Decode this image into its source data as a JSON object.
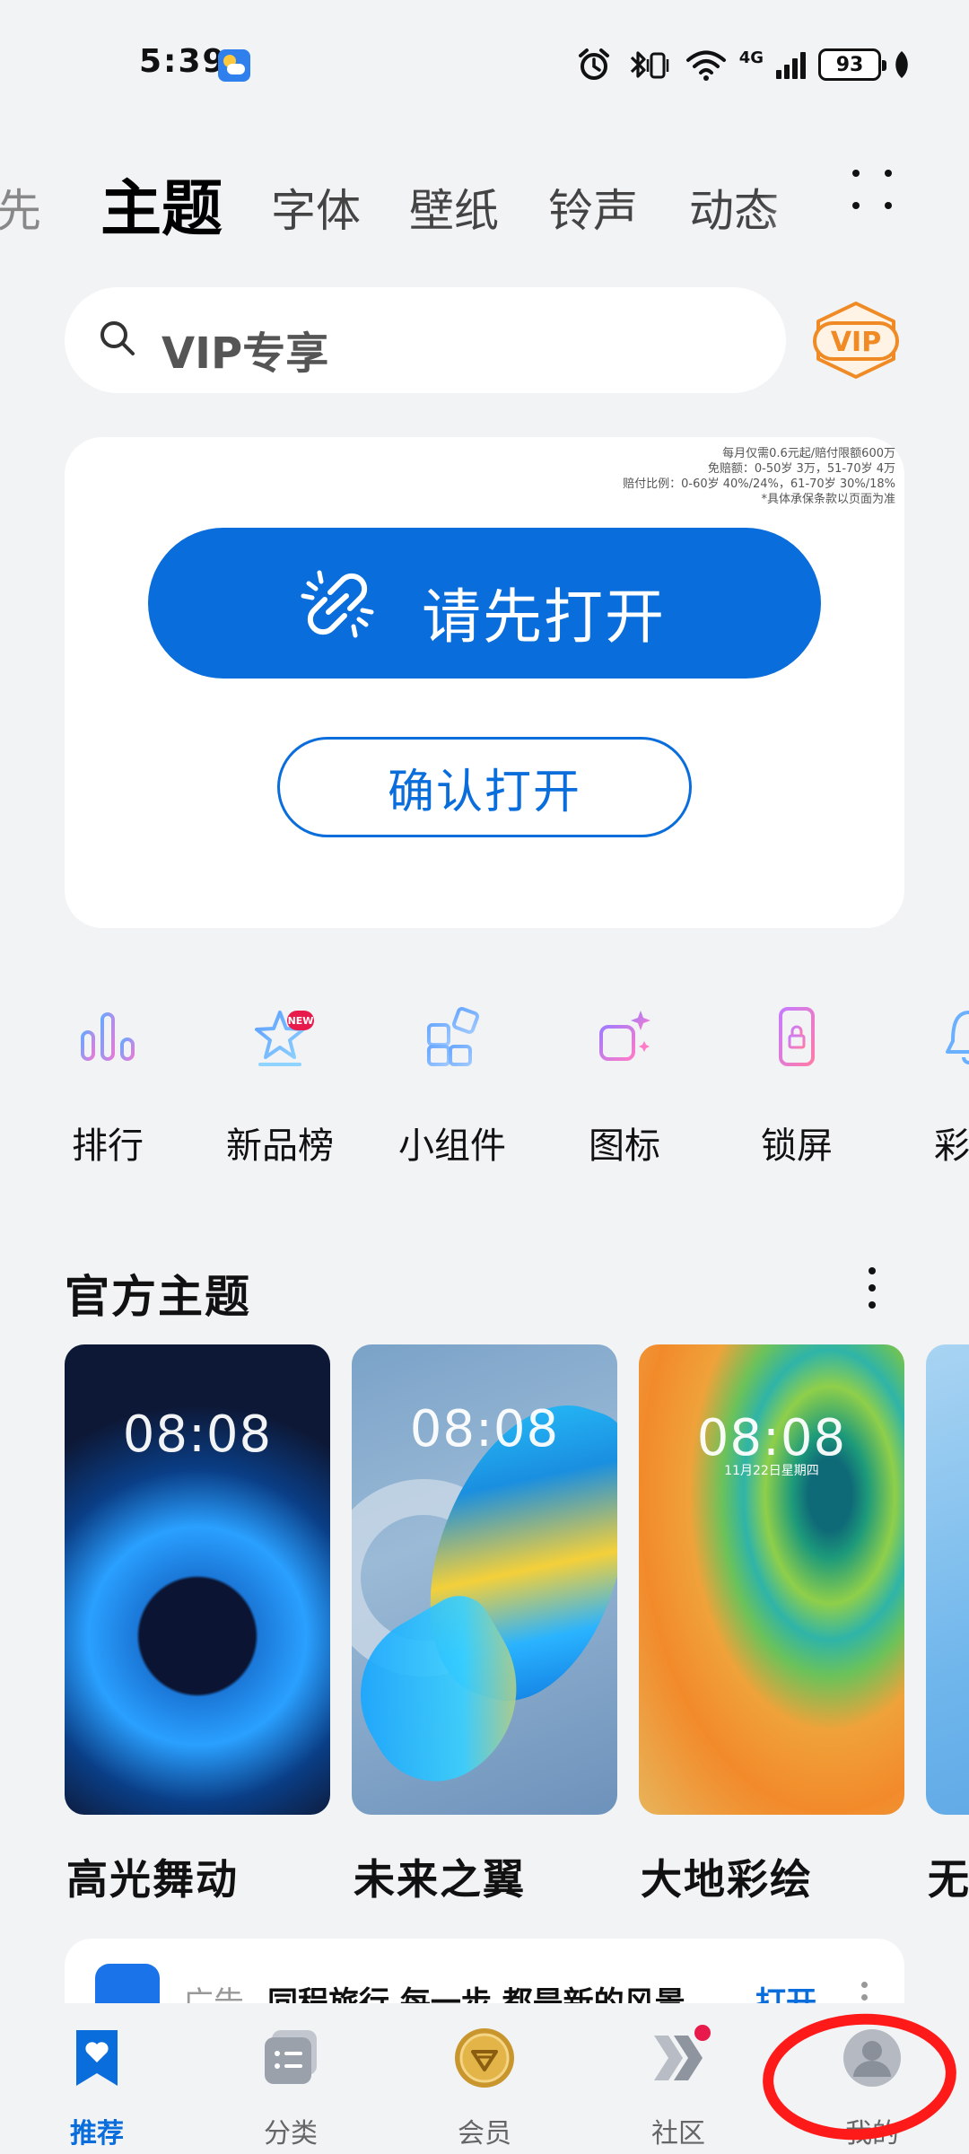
{
  "status_bar": {
    "time": "5:39",
    "network": "4G",
    "battery": "93"
  },
  "tabs": [
    {
      "label": "先",
      "active": false
    },
    {
      "label": "主题",
      "active": true
    },
    {
      "label": "字体",
      "active": false
    },
    {
      "label": "壁纸",
      "active": false
    },
    {
      "label": "铃声",
      "active": false
    },
    {
      "label": "动态",
      "active": false
    }
  ],
  "search": {
    "placeholder": "VIP专享"
  },
  "vip_badge": "VIP",
  "card": {
    "ad_info": [
      "每月仅需0.6元起/赔付限额600万",
      "免赔额：0-50岁 3万，51-70岁 4万",
      "赔付比例：0-60岁 40%/24%，61-70岁 30%/18%",
      "*具体承保条款以页面为准"
    ],
    "primary_label": "请先打开",
    "secondary_label": "确认打开"
  },
  "shortcuts": [
    {
      "label": "排行",
      "icon": "bar-chart-icon"
    },
    {
      "label": "新品榜",
      "icon": "star-icon"
    },
    {
      "label": "小组件",
      "icon": "widget-icon"
    },
    {
      "label": "图标",
      "icon": "icon-sparkle-icon"
    },
    {
      "label": "锁屏",
      "icon": "lock-screen-icon"
    },
    {
      "label": "彩",
      "icon": "bell-icon"
    }
  ],
  "new_badge": "NEW",
  "section": {
    "title": "官方主题"
  },
  "themes": [
    {
      "name": "高光舞动",
      "time": "08:08",
      "date": ""
    },
    {
      "name": "未来之翼",
      "time": "08:08",
      "date": ""
    },
    {
      "name": "大地彩绘",
      "time": "08:08",
      "date": "11月22日星期四"
    },
    {
      "name": "无",
      "time": "",
      "date": ""
    }
  ],
  "ad_strip": {
    "tag": "广告",
    "title": "同程旅行 每一步 都是新的风景",
    "action": "打开"
  },
  "bottom_nav": [
    {
      "label": "推荐",
      "icon": "bookmark-heart-icon",
      "active": true
    },
    {
      "label": "分类",
      "icon": "category-icon",
      "active": false
    },
    {
      "label": "会员",
      "icon": "member-coin-icon",
      "active": false
    },
    {
      "label": "社区",
      "icon": "community-chevron-icon",
      "active": false
    },
    {
      "label": "我的",
      "icon": "profile-icon",
      "active": false
    }
  ],
  "colors": {
    "accent": "#0a6ddc",
    "background": "#f1f3f5",
    "badge_red": "#e8194b",
    "vip_orange": "#f08a24",
    "annotation_red": "#ff1a1a"
  }
}
